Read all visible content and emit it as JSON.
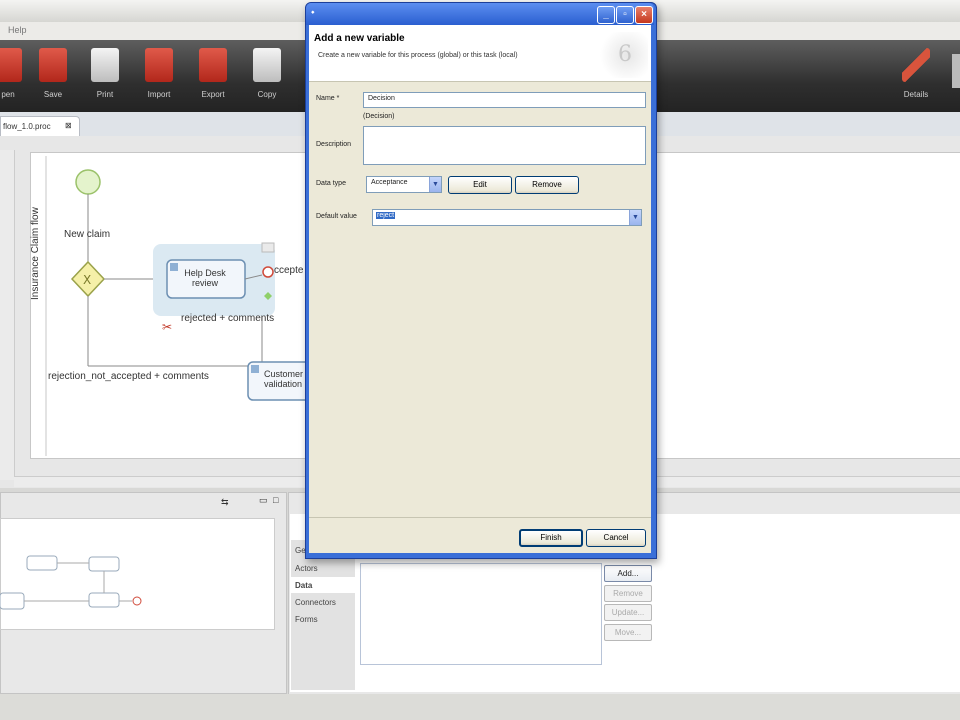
{
  "app": {
    "menu": {
      "help": "Help"
    },
    "toolbar": [
      {
        "label": "pen",
        "icon": "open-icon"
      },
      {
        "label": "Save",
        "icon": "save-icon"
      },
      {
        "label": "Print",
        "icon": "print-icon"
      },
      {
        "label": "Import",
        "icon": "import-icon"
      },
      {
        "label": "Export",
        "icon": "export-icon"
      },
      {
        "label": "Copy",
        "icon": "copy-icon"
      }
    ],
    "toolbar_right": {
      "label": "Details",
      "icon": "pencil-icon"
    },
    "editor_tab": "flow_1.0.proc"
  },
  "diagram": {
    "pool_label": "Insurance Claim flow",
    "start_label": "New claim",
    "task_helpdesk": "Help Desk review",
    "task_customer": "Customer validation",
    "edge_accepted": "ccepte",
    "edge_rejected": "rejected + comments",
    "edge_rejection_not_accepted": "rejection_not_accepted + comments"
  },
  "properties": {
    "tabs": [
      "Ge",
      "Actors",
      "Data",
      "Connectors",
      "Forms"
    ],
    "active_tab": "Data",
    "buttons": [
      "Add...",
      "Remove",
      "Update...",
      "Move..."
    ]
  },
  "dialog": {
    "title": "Add a new variable",
    "description": "Create a new variable for this process (global) or this task (local)",
    "name_label": "Name *",
    "name_value": "Decision",
    "name_hint": "(Decision)",
    "description_label": "Description",
    "description_value": "",
    "datatype_label": "Data type",
    "datatype_value": "Acceptance",
    "edit_button": "Edit",
    "remove_button": "Remove",
    "default_label": "Default value",
    "default_value": "reject",
    "finish_button": "Finish",
    "cancel_button": "Cancel",
    "accent": "#2a5fd0"
  }
}
